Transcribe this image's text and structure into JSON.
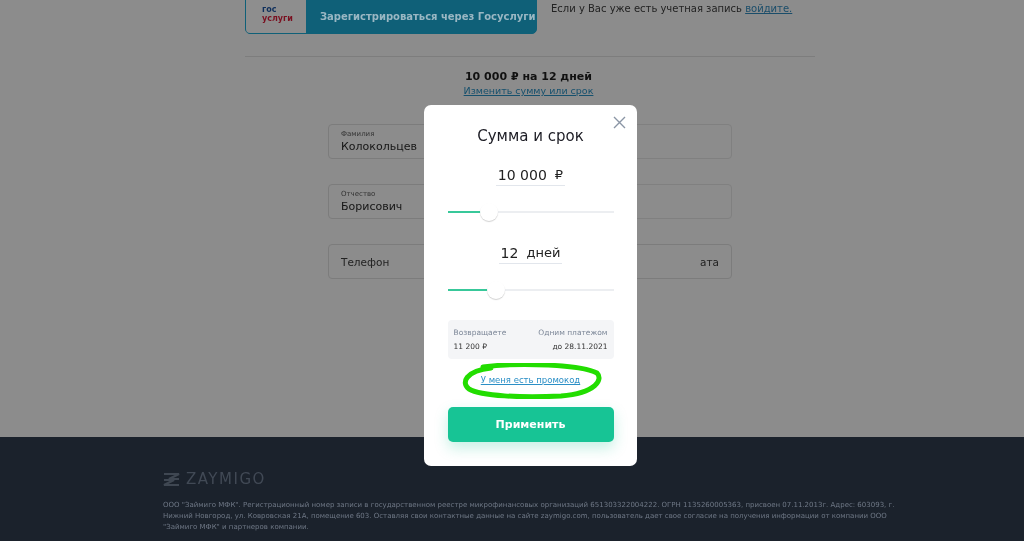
{
  "gosuslugi_button": {
    "logo_text": [
      "гос",
      "услуги"
    ],
    "label": "Зарегистрироваться через Госуслуги"
  },
  "login_prompt": {
    "text": "Если у Вас уже есть учетная запись",
    "link": "войдите."
  },
  "summary": {
    "title": "10 000 ₽ на 12 дней",
    "link": "Изменить сумму или срок"
  },
  "fields": [
    {
      "kind": "filled",
      "label": "Фамилия"
    },
    {
      "kind": "blank"
    },
    {
      "kind": "filled",
      "label": "Отчество",
      "value": "Борисович"
    },
    {
      "kind": "blank"
    },
    {
      "kind": "empty",
      "placeholder": "Телефон"
    },
    {
      "kind": "empty",
      "placeholder": "ата"
    }
  ],
  "surname_value": "Колокольцев",
  "modal": {
    "title": "Сумма и срок",
    "sliders": [
      {
        "value": "10 000",
        "unit": "₽",
        "level": 0.25
      },
      {
        "value": "12",
        "unit": "дней",
        "level": 0.29
      }
    ],
    "repay": {
      "label": "Возвращаете",
      "amount": "11 200 ₽",
      "mode": "Одним платежом",
      "date": "до 28.11.2021"
    },
    "promo_link": "У меня есть промокод",
    "promo_highlighted": true,
    "apply_button": "Применить"
  },
  "footer": {
    "logo": "ZAYMIGO",
    "legal": "ООО \"Займиго МФК\". Регистрационный номер записи в государственном реестре микрофинансовых организаций 651303322004222. ОГРН 1135260005363, присвоен 07.11.2013г. Адрес: 603093, г. Нижний Новгород, ул. Ковровская 21А, помещение 603. Оставляя свои контактные данные на сайте zaymigo.com, пользователь дает свое согласие на получения информации от компании ООО \"Займиго МФК\" и партнеров компании."
  }
}
